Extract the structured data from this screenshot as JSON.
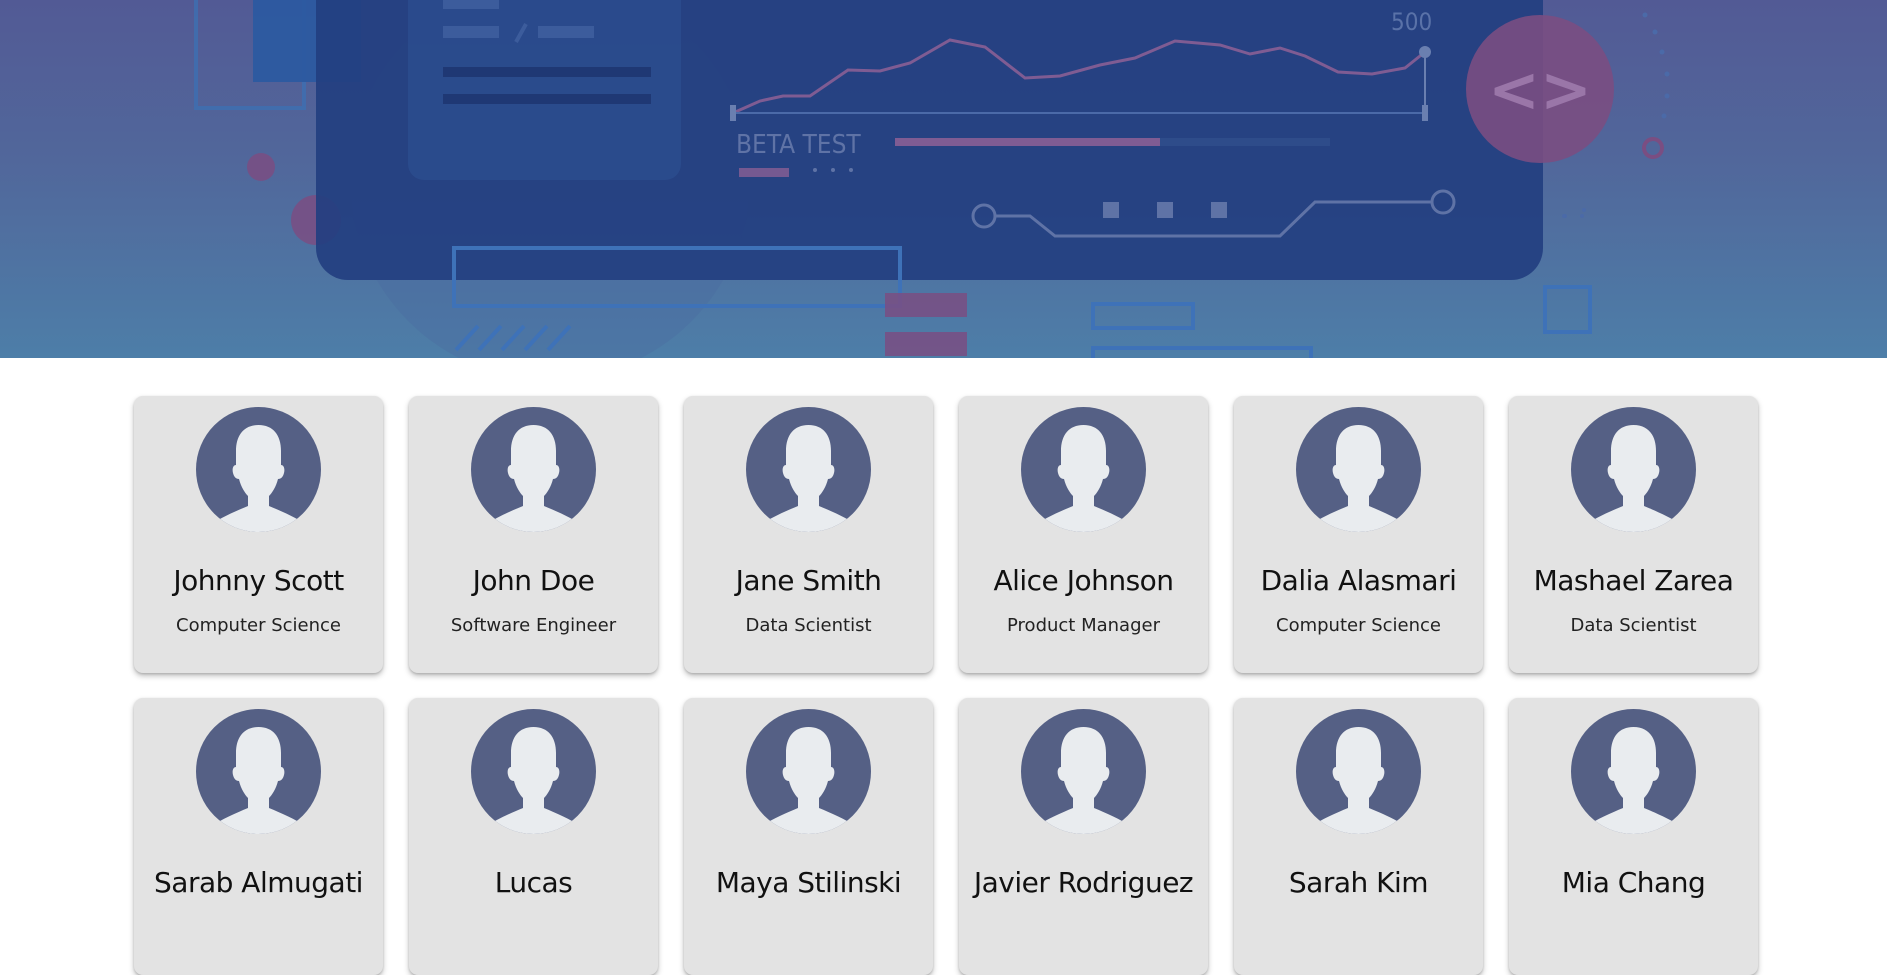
{
  "banner": {
    "chart_max_label": "500",
    "beta_label": "BETA TEST",
    "code_symbol": "<>"
  },
  "colors": {
    "card_background": "#e3e3e3",
    "avatar_background": "#556085",
    "avatar_silhouette": "#e9ecef",
    "hero_top": "#525a95",
    "hero_bottom": "#4d7ea8",
    "panel": "#233f80"
  },
  "profiles": [
    {
      "name": "Johnny Scott",
      "role": "Computer Science",
      "icon": "user-avatar-icon"
    },
    {
      "name": "John Doe",
      "role": "Software Engineer",
      "icon": "user-avatar-icon"
    },
    {
      "name": "Jane Smith",
      "role": "Data Scientist",
      "icon": "user-avatar-icon"
    },
    {
      "name": "Alice Johnson",
      "role": "Product Manager",
      "icon": "user-avatar-icon"
    },
    {
      "name": "Dalia Alasmari",
      "role": "Computer Science",
      "icon": "user-avatar-icon"
    },
    {
      "name": "Mashael Zarea",
      "role": "Data Scientist",
      "icon": "user-avatar-icon"
    },
    {
      "name": "Sarab Almugati",
      "role": "",
      "icon": "user-avatar-icon"
    },
    {
      "name": "Lucas",
      "role": "",
      "icon": "user-avatar-icon"
    },
    {
      "name": "Maya Stilinski",
      "role": "",
      "icon": "user-avatar-icon"
    },
    {
      "name": "Javier Rodriguez",
      "role": "",
      "icon": "user-avatar-icon"
    },
    {
      "name": "Sarah Kim",
      "role": "",
      "icon": "user-avatar-icon"
    },
    {
      "name": "Mia Chang",
      "role": "",
      "icon": "user-avatar-icon"
    }
  ]
}
